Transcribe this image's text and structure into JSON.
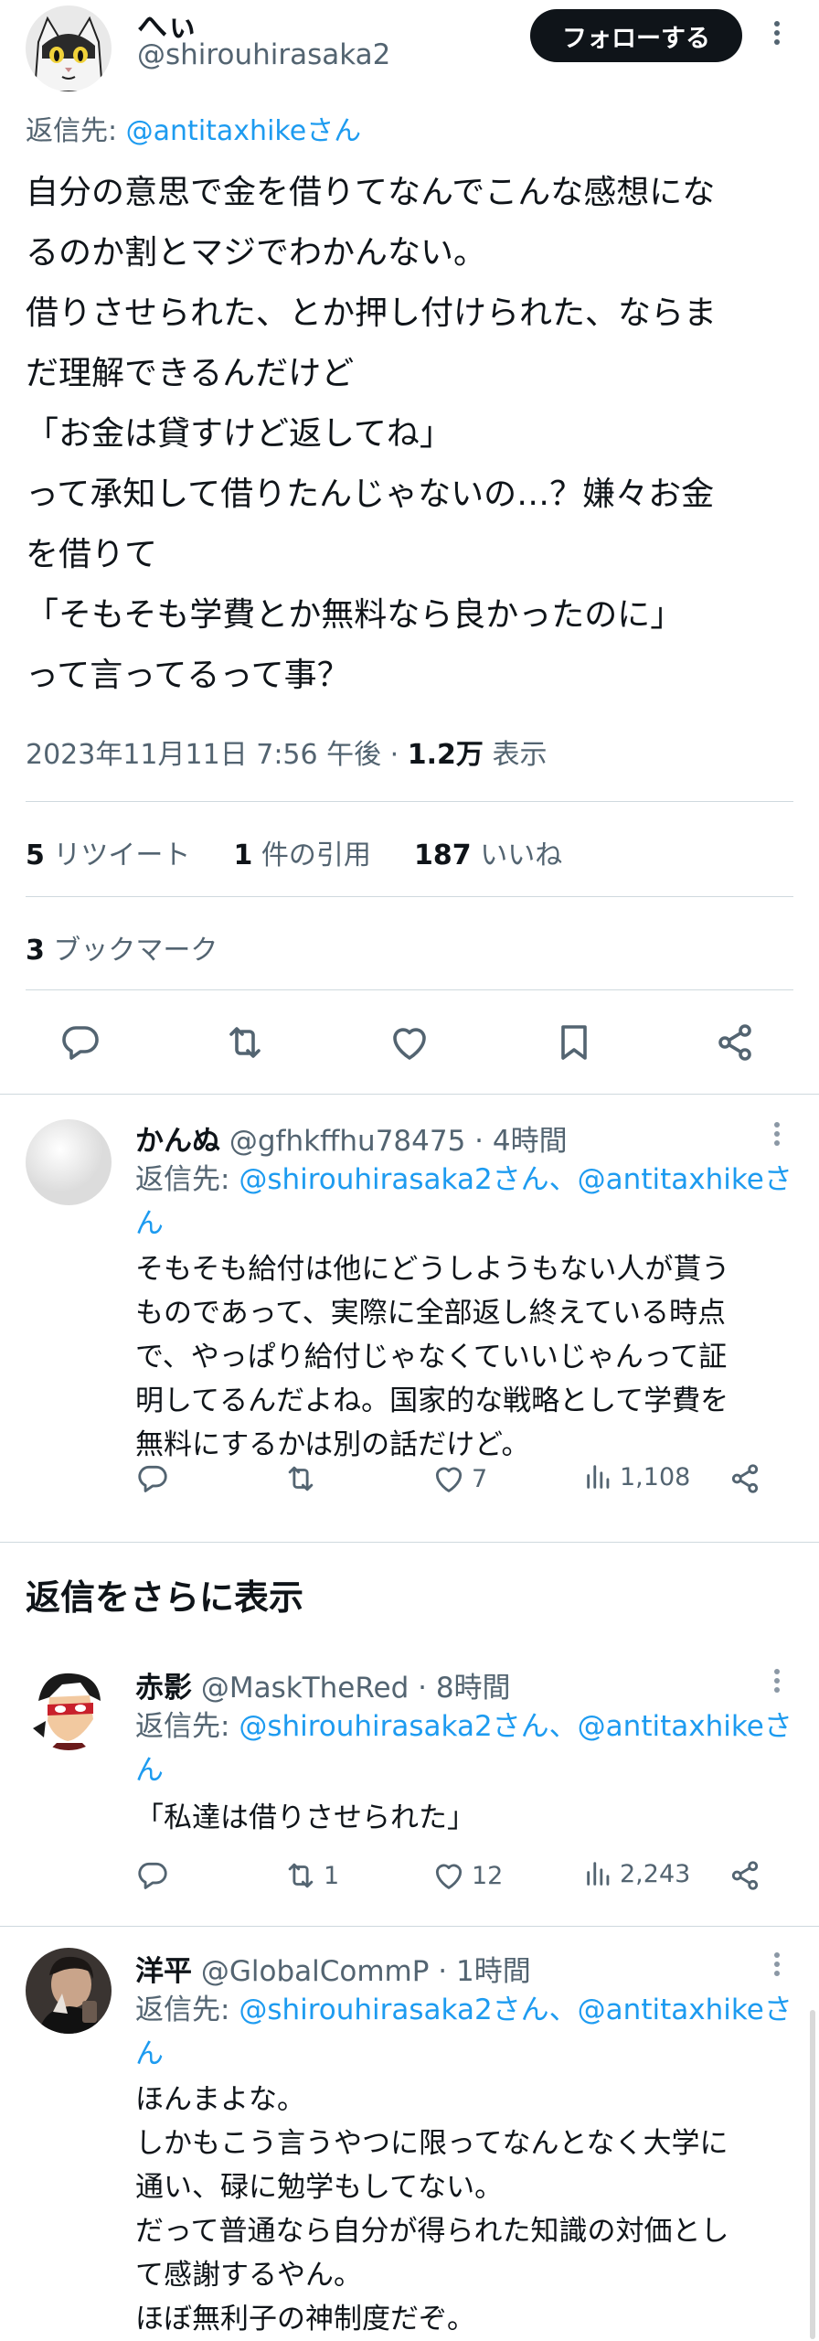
{
  "main_tweet": {
    "display_name": "へぃ",
    "handle": "@shirouhirasaka2",
    "follow_label": "フォローする",
    "reply_to_prefix": "返信先: ",
    "reply_to_user": "@antitaxhikeさん",
    "text_lines": [
      "自分の意思で金を借りてなんでこんな感想にな",
      "るのか割とマジでわかんない。",
      "借りさせられた、とか押し付けられた、ならま",
      "だ理解できるんだけど",
      "「お金は貸すけど返してね」",
      "って承知して借りたんじゃないの…？嫌々お金",
      "を借りて",
      "「そもそも学費とか無料なら良かったのに」",
      "って言ってるって事？"
    ],
    "timestamp": "2023年11月11日 7:56 午後",
    "views_count": "1.2万",
    "views_label": " 表示",
    "retweets_count": "5",
    "retweets_label": " リツイート",
    "quotes_count": "1",
    "quotes_label": " 件の引用",
    "likes_count": "187",
    "likes_label": " いいね",
    "bookmarks_count": "3",
    "bookmarks_label": " ブックマーク"
  },
  "replies": [
    {
      "display_name": "かんぬ",
      "handle": "@gfhkffhu78475",
      "time": "4時間",
      "reply_to_prefix": "返信先: ",
      "reply_to_users": "@shirouhirasaka2さん、@antitaxhikeさん",
      "text_lines": [
        "そもそも給付は他にどうしようもない人が貰う",
        "ものであって、実際に全部返し終えている時点",
        "で、やっぱり給付じゃなくていいじゃんって証",
        "明してるんだよね。国家的な戦略として学費を",
        "無料にするかは別の話だけど。"
      ],
      "retweets": "",
      "likes": "7",
      "views": "1,108"
    },
    {
      "display_name": "赤影",
      "handle": "@MaskTheRed",
      "time": "8時間",
      "reply_to_prefix": "返信先: ",
      "reply_to_users": "@shirouhirasaka2さん、@antitaxhikeさん",
      "text_lines": [
        "「私達は借りさせられた」"
      ],
      "retweets": "1",
      "likes": "12",
      "views": "2,243"
    },
    {
      "display_name": "洋平",
      "handle": "@GlobalCommP",
      "time": "1時間",
      "reply_to_prefix": "返信先: ",
      "reply_to_users": "@shirouhirasaka2さん、@antitaxhikeさん",
      "text_lines": [
        "ほんまよな。",
        "しかもこう言うやつに限ってなんとなく大学に",
        "通い、碌に勉学もしてない。",
        "だって普通なら自分が得られた知識の対価とし",
        "て感謝するやん。",
        "ほぼ無利子の神制度だぞ。"
      ]
    }
  ],
  "more_replies_label": "返信をさらに表示",
  "colors": {
    "text": "#0f1419",
    "muted": "#536471",
    "link": "#1d9bf0",
    "divider": "#cfd9de",
    "follow_button": "#0f1419"
  }
}
